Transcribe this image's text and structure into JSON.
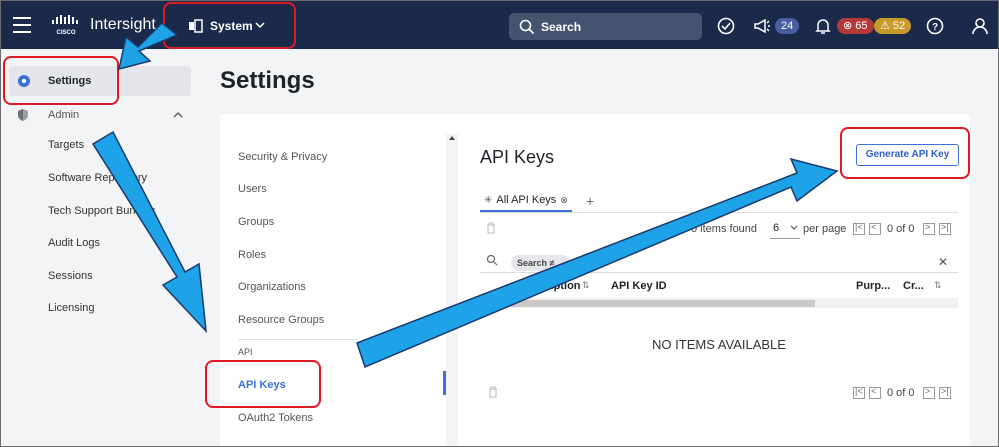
{
  "topbar": {
    "brand": "Intersight",
    "system_label": "System",
    "search_label": "Search",
    "notifications_count": "24",
    "critical_count": "65",
    "warning_count": "52"
  },
  "leftnav": {
    "settings_label": "Settings",
    "admin_label": "Admin",
    "items": [
      "Targets",
      "Software Repository",
      "Tech Support Bundles",
      "Audit Logs",
      "Sessions",
      "Licensing"
    ]
  },
  "page": {
    "title": "Settings"
  },
  "subnav": {
    "items": [
      "Security & Privacy",
      "Users",
      "Groups",
      "Roles",
      "Organizations",
      "Resource Groups"
    ],
    "section_label": "API",
    "api_keys": "API Keys",
    "oauth_tokens": "OAuth2 Tokens"
  },
  "content": {
    "title": "API Keys",
    "generate_button": "Generate API Key",
    "tab_label": "All API Keys",
    "found_text": "0 items found",
    "per_page_value": "6",
    "per_page_label": "per page",
    "page_of": "0 of 0",
    "search_chip": "Search ≠",
    "columns": [
      "Description",
      "API Key ID",
      "Purp...",
      "Cr..."
    ],
    "empty_text": "NO ITEMS AVAILABLE"
  },
  "colors": {
    "topbar": "#1b2a4a",
    "accent": "#3c6fd8",
    "annotation_red": "#e01a22",
    "annotation_arrow": "#1ea2e8"
  }
}
